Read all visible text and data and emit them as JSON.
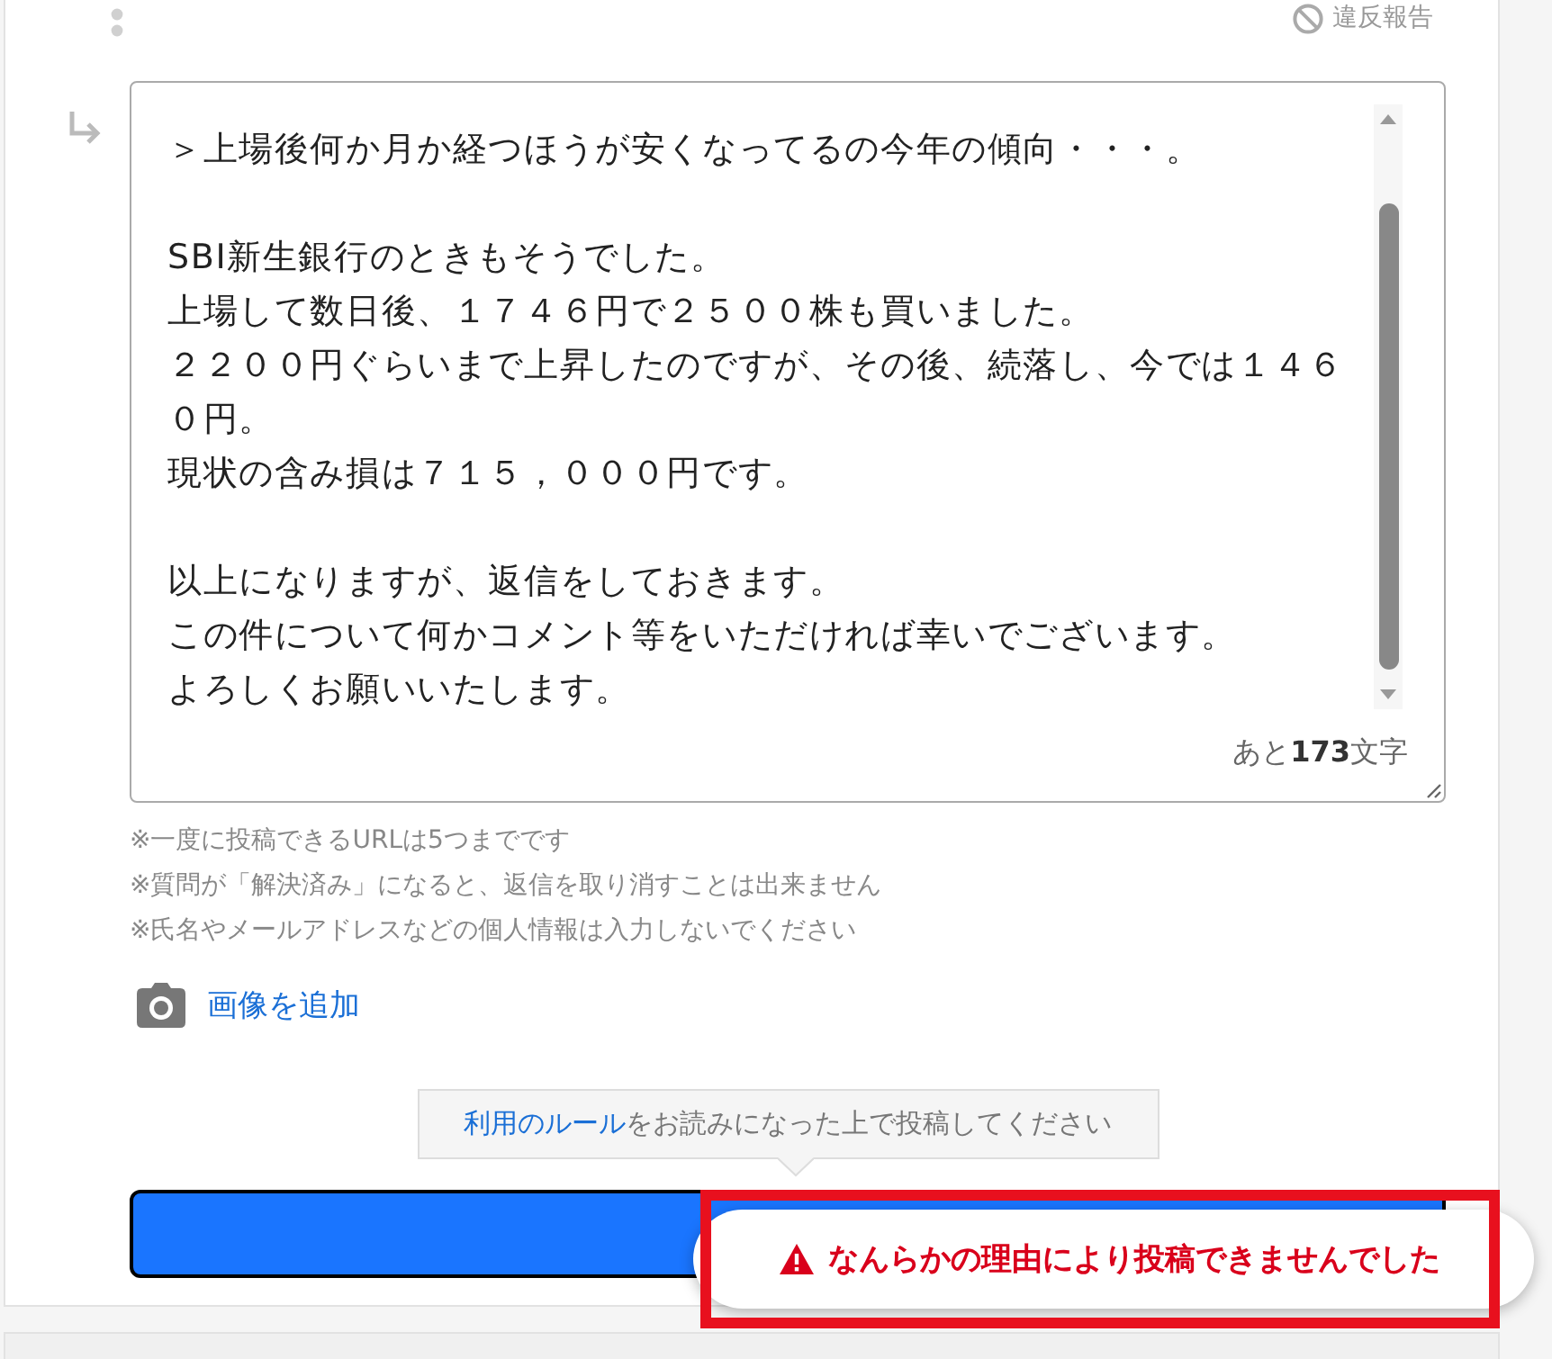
{
  "header": {
    "report_label": "違反報告"
  },
  "reply": {
    "paragraphs": [
      {
        "lines": [
          "＞上場後何か月か経つほうが安くなってるの今年の傾向・・・。"
        ]
      },
      {
        "lines": [
          "SBI新生銀行のときもそうでした。",
          "上場して数日後、１７４６円で２５００株も買いました。",
          "２２００円ぐらいまで上昇したのですが、その後、続落し、今では１４６",
          "０円。",
          "現状の含み損は７１５，０００円です。"
        ]
      },
      {
        "lines": [
          "以上になりますが、返信をしておきます。",
          "この件について何かコメント等をいただければ幸いでございます。",
          "よろしくお願いいたします。"
        ]
      }
    ],
    "counter": "あと**173**文字"
  },
  "notes": [
    "※一度に投稿できるURLは5つまでです",
    "※質問が「解決済み」になると、返信を取り消すことは出来ません",
    "※氏名やメールアドレスなどの個人情報は入力しないでください"
  ],
  "add_image": {
    "label": "画像を追加"
  },
  "rules_tooltip": {
    "link": "利用のルール",
    "text": "をお読みになった上で投稿してください"
  },
  "submit_button": {
    "focused": true
  },
  "toast": {
    "kind": "error",
    "message": "なんらかの理由により投稿できませんでした",
    "highlighted": true
  }
}
